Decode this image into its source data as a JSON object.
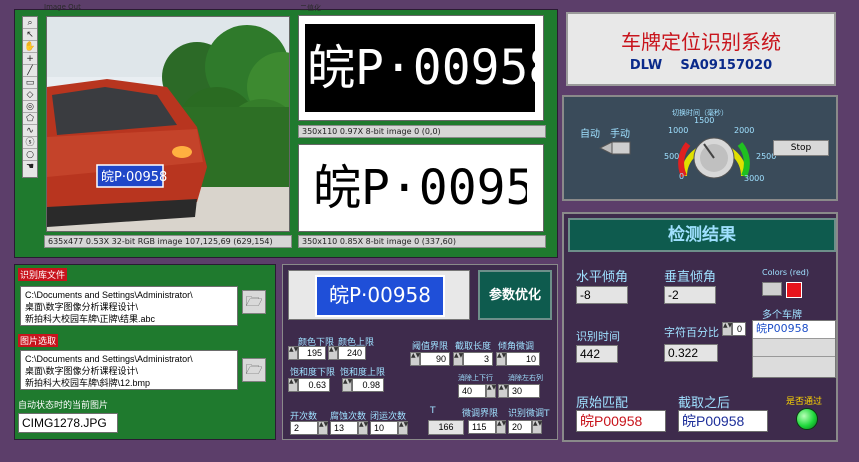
{
  "image_panel": {
    "image_out_label": "Image Out",
    "binary_label": "二值化",
    "status_color": "635x477 0.53X 32-bit RGB image 107,125,69   (629,154)",
    "status_bin1": "350x110 0.97X 8-bit image 0    (0,0)",
    "status_bin2": "350x110 0.85X 8-bit image 0    (337,60)",
    "plate_text": "皖P·00958"
  },
  "title_panel": {
    "title": "车牌定位识别系统",
    "subtitle": "DLW    SA09157020"
  },
  "control_panel": {
    "auto_label": "自动",
    "manual_label": "手动",
    "knob_title": "切换时间（毫秒）",
    "ticks": [
      "0",
      "500",
      "1000",
      "1500",
      "2000",
      "2500",
      "3000"
    ],
    "stop_label": "Stop"
  },
  "file_panel": {
    "recog_file_label": "识别库文件",
    "recog_file_path": [
      "C:\\Documents and Settings\\Administrator\\",
      "桌面\\数字图像分析课程设计\\",
      "新拍科大校园车牌\\正牌\\结果.abc"
    ],
    "image_select_label": "图片选取",
    "image_path": [
      "C:\\Documents and Settings\\Administrator\\",
      "桌面\\数字图像分析课程设计\\",
      "新拍科大校园车牌\\斜牌\\12.bmp"
    ],
    "current_image_label": "自动状态时的当前图片",
    "current_image": "CIMG1278.JPG"
  },
  "param_panel": {
    "optimize_label": "参数优化",
    "plate_text": "皖P·00958",
    "color_low_label": "颜色下限",
    "color_high_label": "颜色上限",
    "color_low": "195",
    "color_high": "240",
    "thresh_label": "阈值界限",
    "crop_len_label": "截取长度",
    "tilt_label": "倾角微调",
    "thresh": "90",
    "crop_len": "3",
    "tilt": "10",
    "sat_low_label": "饱和度下限",
    "sat_high_label": "饱和度上限",
    "sat_low": "0.63",
    "sat_high": "0.98",
    "remove_ud_label": "消除上下行",
    "remove_lr_label": "消除左右列",
    "remove_ud": "40",
    "remove_lr": "30",
    "open_label": "开次数",
    "erode_label": "腐蚀次数",
    "close_label": "闭运次数",
    "open_val": "2",
    "erode_val": "13",
    "close_val": "10",
    "t_label": "T",
    "fine_label": "微调界限",
    "recog_fine_label": "识别微调T",
    "t_val": "166",
    "fine_val": "115",
    "recog_fine_val": "20"
  },
  "result_panel": {
    "header": "检测结果",
    "h_angle_label": "水平倾角",
    "v_angle_label": "垂直倾角",
    "h_angle": "-8",
    "v_angle": "-2",
    "colors_label": "Colors (red)",
    "multi_plate_label": "多个车牌",
    "multi_plate_value": "皖P00958",
    "recog_time_label": "识别时间",
    "recog_time": "442",
    "char_percent_label": "字符百分比",
    "char_percent_index": "0",
    "char_percent": "0.322",
    "original_label": "原始匹配",
    "cropped_label": "截取之后",
    "pass_label": "是否通过",
    "original_value": "皖P00958",
    "cropped_value": "皖P00958"
  },
  "colors": {
    "green_frame": "#1f7a2e",
    "dark_panel": "#3e2b4c",
    "led_green": "#1dd83a",
    "red_swatch": "#e8141c"
  }
}
